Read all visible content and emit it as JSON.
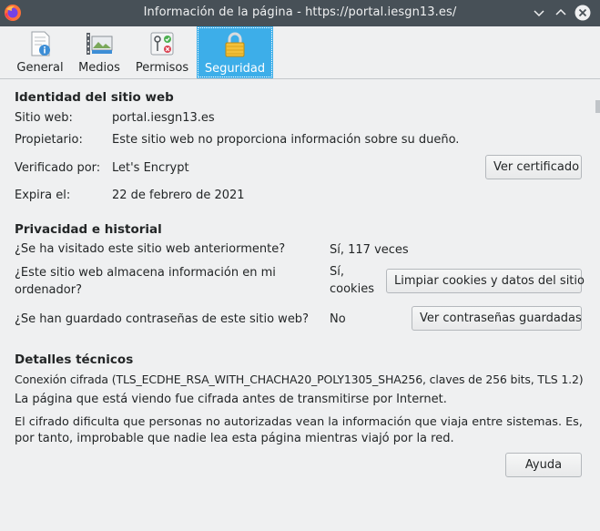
{
  "window": {
    "title": "Información de la página - https://portal.iesgn13.es/"
  },
  "tabs": [
    {
      "label": "General",
      "icon": "document-info-icon"
    },
    {
      "label": "Medios",
      "icon": "media-icon"
    },
    {
      "label": "Permisos",
      "icon": "permissions-icon"
    },
    {
      "label": "Seguridad",
      "icon": "padlock-icon",
      "selected": true
    }
  ],
  "identity": {
    "heading": "Identidad del sitio web",
    "website_label": "Sitio web:",
    "website_value": "portal.iesgn13.es",
    "owner_label": "Propietario:",
    "owner_value": "Este sitio web no proporciona información sobre su dueño.",
    "verified_label": "Verificado por:",
    "verified_value": "Let's Encrypt",
    "view_cert_button": "Ver certificado",
    "expires_label": "Expira el:",
    "expires_value": "22 de febrero de 2021"
  },
  "privacy": {
    "heading": "Privacidad e historial",
    "visited_question": "¿Se ha visitado este sitio web anteriormente?",
    "visited_answer": "Sí, 117 veces",
    "stores_question_line1": "¿Este sitio web almacena información en mi",
    "stores_question_line2": "ordenador?",
    "stores_answer_line1": "Sí,",
    "stores_answer_line2": "cookies",
    "clear_cookies_button": "Limpiar cookies y datos del sitio",
    "passwords_question": "¿Se han guardado contraseñas de este sitio web?",
    "passwords_answer": "No",
    "view_passwords_button": "Ver contraseñas guardadas"
  },
  "technical": {
    "heading": "Detalles técnicos",
    "connection": "Conexión cifrada (TLS_ECDHE_RSA_WITH_CHACHA20_POLY1305_SHA256, claves de 256 bits, TLS 1.2)",
    "encrypted_note": "La página que está viendo fue cifrada antes de transmitirse por Internet.",
    "explanation_line1": "El cifrado dificulta que personas no autorizadas vean la información que viaja entre sistemas. Es,",
    "explanation_line2": "por tanto, improbable que nadie lea esta página mientras viajó por la red."
  },
  "help_button": "Ayuda",
  "colors": {
    "titlebar": "#475057",
    "background": "#eff0f1",
    "selection": "#3daee9"
  }
}
